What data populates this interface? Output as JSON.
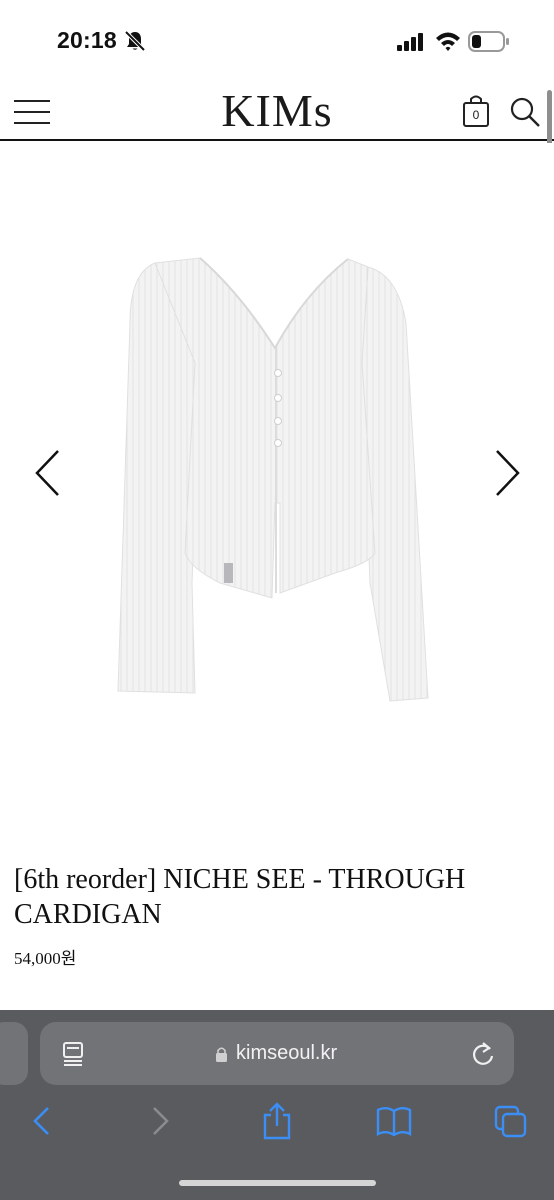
{
  "status_bar": {
    "time": "20:18",
    "icons": [
      "bell-slash-icon",
      "signal-icon",
      "wifi-icon",
      "battery-icon"
    ]
  },
  "header": {
    "brand": "KIMs",
    "cart_count": "0",
    "icons": [
      "menu-icon",
      "cart-icon",
      "search-icon"
    ]
  },
  "gallery": {
    "image": "white-ribbed-cardigan-image",
    "icons": [
      "chevron-left-icon",
      "chevron-right-icon"
    ]
  },
  "product": {
    "title": "[6th reorder] NICHE SEE - THROUGH CARDIGAN",
    "price": "54,000원"
  },
  "browser": {
    "url": "kimseoul.kr",
    "icons": [
      "tab-overview-icon",
      "lock-icon",
      "reload-icon",
      "back-icon",
      "forward-icon",
      "share-icon",
      "bookmarks-icon",
      "tabs-icon"
    ]
  },
  "colors": {
    "browser_bar": "#5a5b5e",
    "address_bar": "#727377",
    "toolbar_accent": "#3a8ef6",
    "toolbar_disabled": "#8a8b8e"
  }
}
